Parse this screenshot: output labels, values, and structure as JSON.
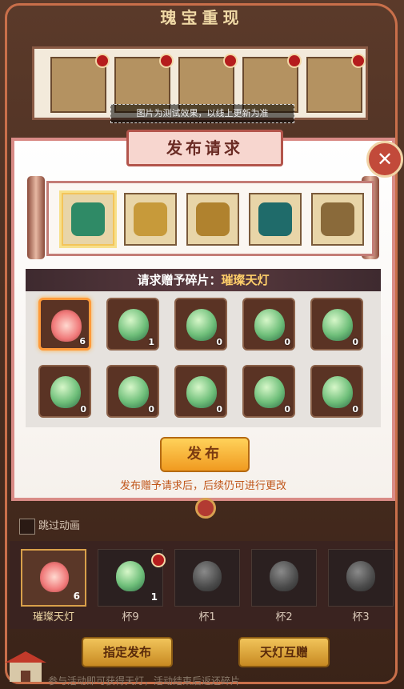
{
  "background_title": "瑰宝重现",
  "notice": "图片为测试效果，以线上更新为准",
  "modal": {
    "title": "发布请求",
    "close_icon": "close-icon",
    "request_label": "请求赠予碎片：",
    "request_target": "璀璨天灯",
    "publish_label": "发布",
    "hint": "发布赠予请求后，后续仍可进行更改"
  },
  "treasures": [
    {
      "name": "treasure-jade-tree",
      "color": "#2f8a66"
    },
    {
      "name": "treasure-dragon-seal",
      "color": "#c79a3a"
    },
    {
      "name": "treasure-bronze-bowl",
      "color": "#b0822e"
    },
    {
      "name": "treasure-jade-vase",
      "color": "#1f6b6a"
    },
    {
      "name": "treasure-bronze-ding",
      "color": "#8a6a3a"
    }
  ],
  "fragments": [
    {
      "count": "6",
      "type": "lotus"
    },
    {
      "count": "1",
      "type": "lamp"
    },
    {
      "count": "0",
      "type": "lamp"
    },
    {
      "count": "0",
      "type": "lamp"
    },
    {
      "count": "0",
      "type": "lamp"
    },
    {
      "count": "0",
      "type": "lamp"
    },
    {
      "count": "0",
      "type": "lamp"
    },
    {
      "count": "0",
      "type": "lamp"
    },
    {
      "count": "0",
      "type": "lamp"
    },
    {
      "count": "0",
      "type": "lamp"
    }
  ],
  "skip_animation": "跳过动画",
  "bottom_items": [
    {
      "label": "璀璨天灯",
      "count": "6"
    },
    {
      "label": "杯9",
      "count": "1"
    },
    {
      "label": "杯1",
      "count": ""
    },
    {
      "label": "杯2",
      "count": ""
    },
    {
      "label": "杯3",
      "count": ""
    }
  ],
  "buttons": {
    "assign_publish": "指定发布",
    "lamp_exchange": "天灯互赠"
  },
  "footer": "参与活动即可获得天灯，活动结束后返还碎片"
}
